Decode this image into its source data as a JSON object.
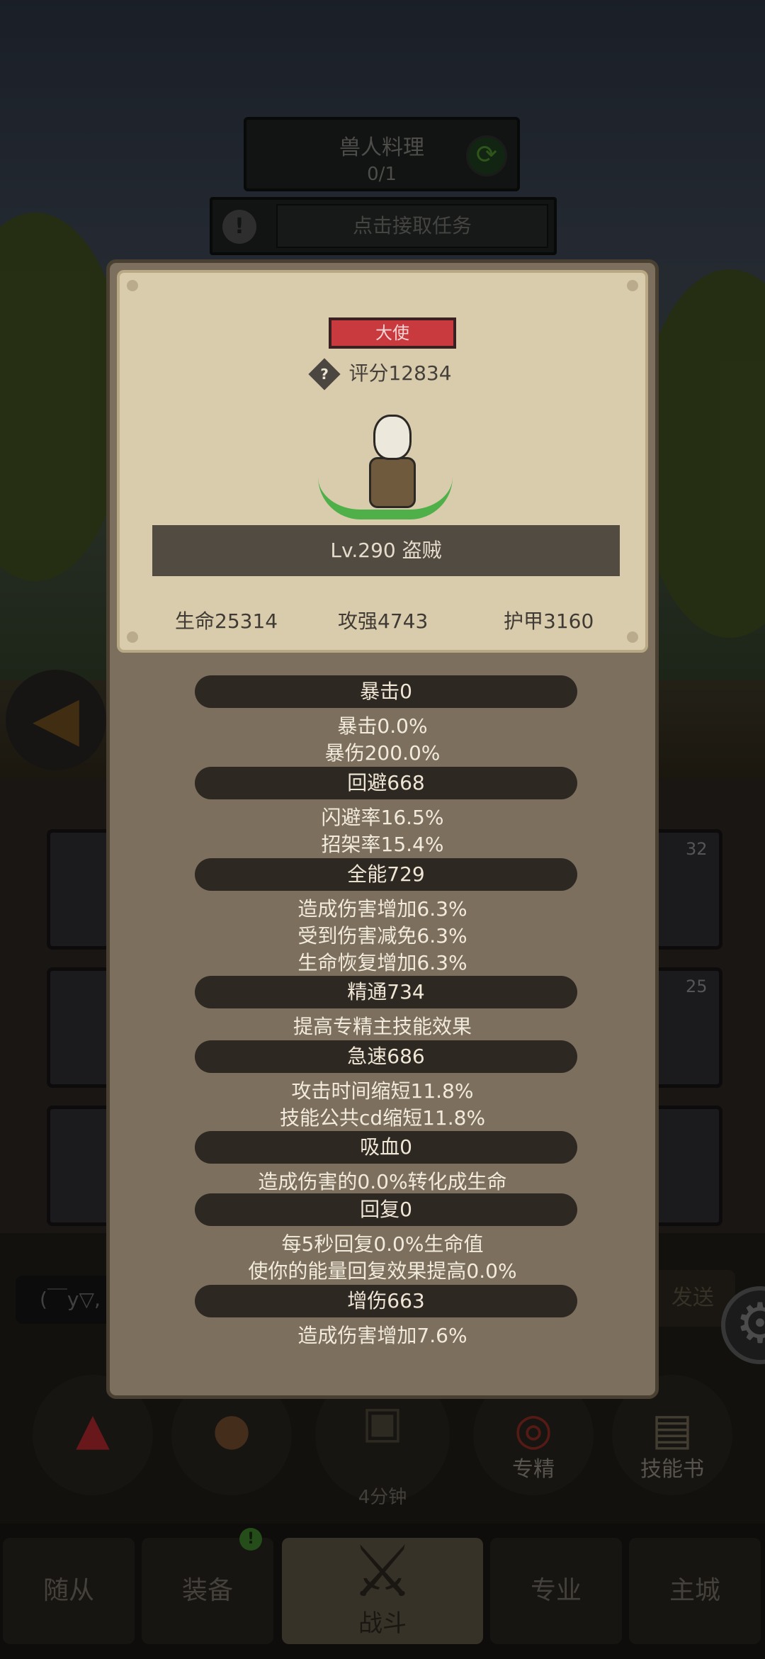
{
  "quest": {
    "name": "兽人料理",
    "progress": "0/1",
    "accept": "点击接取任务"
  },
  "background": {
    "badges": [
      "32",
      "25"
    ],
    "chat_placeholder": "(￣y▽,",
    "send": "发送",
    "actions": [
      "专精",
      "技能书"
    ],
    "chest_timer": "4分钟",
    "tabs": [
      "随从",
      "装备",
      "战斗",
      "专业",
      "主城"
    ],
    "equipment_notice": "!"
  },
  "panel": {
    "rank": "大使",
    "score": "评分12834",
    "class": "Lv.290 盗贼",
    "stats": {
      "hp": "生命25314",
      "attack": "攻强4743",
      "armor": "护甲3160"
    },
    "attributes": [
      {
        "title": "暴击0",
        "lines": [
          "暴击0.0%",
          "暴伤200.0%"
        ]
      },
      {
        "title": "回避668",
        "lines": [
          "闪避率16.5%",
          "招架率15.4%"
        ]
      },
      {
        "title": "全能729",
        "lines": [
          "造成伤害增加6.3%",
          "受到伤害减免6.3%",
          "生命恢复增加6.3%"
        ]
      },
      {
        "title": "精通734",
        "lines": [
          "提高专精主技能效果"
        ]
      },
      {
        "title": "急速686",
        "lines": [
          "攻击时间缩短11.8%",
          "技能公共cd缩短11.8%"
        ]
      },
      {
        "title": "吸血0",
        "lines": [
          "造成伤害的0.0%转化成生命"
        ]
      },
      {
        "title": "回复0",
        "lines": [
          "每5秒回复0.0%生命值",
          "使你的能量回复效果提高0.0%"
        ]
      },
      {
        "title": "增伤663",
        "lines": [
          "造成伤害增加7.6%"
        ]
      }
    ]
  }
}
